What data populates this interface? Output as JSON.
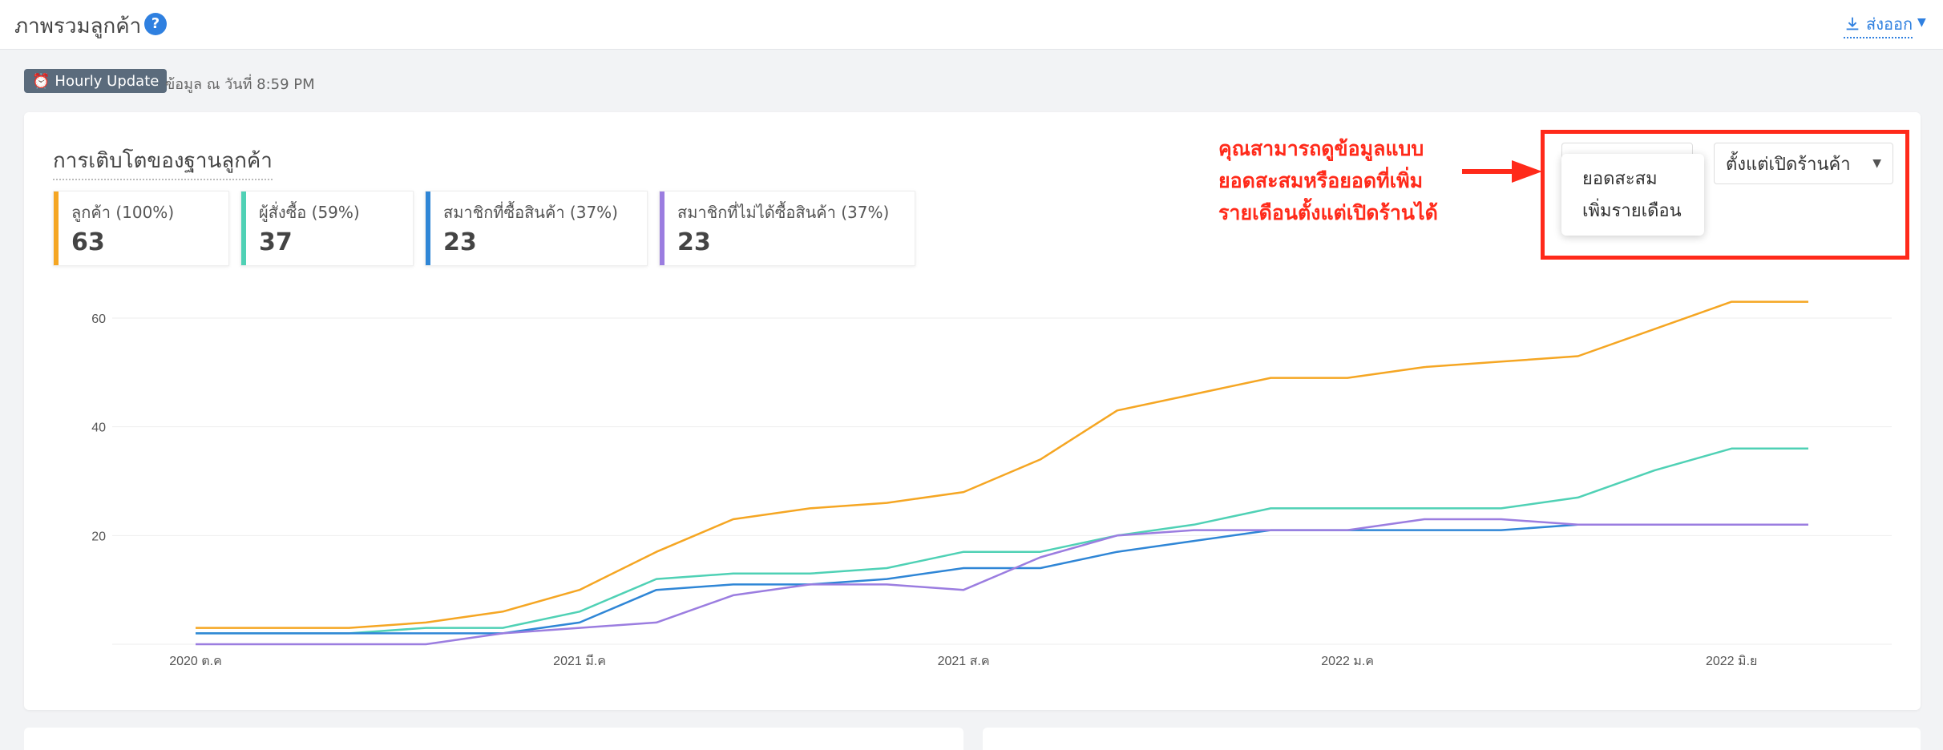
{
  "header": {
    "title": "ภาพรวมลูกค้า",
    "help_icon": "question-circle-icon",
    "export_label": "ส่งออก"
  },
  "update": {
    "badge_label": "Hourly Update",
    "timestamp": "ข้อมูล ณ วันที่ 8:59 PM"
  },
  "card": {
    "title": "การเติบโตของฐานลูกค้า",
    "stats": [
      {
        "label": "ลูกค้า (100%)",
        "value": "63",
        "color": "#f5a623"
      },
      {
        "label": "ผู้สั่งซื้อ (59%)",
        "value": "37",
        "color": "#4fd1b5"
      },
      {
        "label": "สมาชิกที่ซื้อสินค้า (37%)",
        "value": "23",
        "color": "#2f86d6"
      },
      {
        "label": "สมาชิกที่ไม่ได้ซื้อสินค้า (37%)",
        "value": "23",
        "color": "#9b7de0"
      }
    ],
    "annotation_lines": [
      "คุณสามารถดูข้อมูลแบบ",
      "ยอดสะสมหรือยอดที่เพิ่ม",
      "รายเดือนตั้งแต่เปิดร้านได้"
    ],
    "period_select": "ตั้งแต่เปิดร้านค้า",
    "mode_options": [
      "ยอดสะสม",
      "เพิ่มรายเดือน"
    ],
    "annotation_color": "#ff2a1a"
  },
  "chart_data": {
    "type": "line",
    "x": [
      "2020-10",
      "2020-11",
      "2020-12",
      "2021-01",
      "2021-02",
      "2021-03",
      "2021-04",
      "2021-05",
      "2021-06",
      "2021-07",
      "2021-08",
      "2021-09",
      "2021-10",
      "2021-11",
      "2021-12",
      "2022-01",
      "2022-02",
      "2022-03",
      "2022-04",
      "2022-05",
      "2022-06",
      "2022-07"
    ],
    "x_tick_labels": [
      "2020 ต.ค",
      "2021 มี.ค",
      "2021 ส.ค",
      "2022 ม.ค",
      "2022 มิ.ย"
    ],
    "x_tick_positions": [
      "2020-10",
      "2021-03",
      "2021-08",
      "2022-01",
      "2022-06"
    ],
    "ylim": [
      0,
      63
    ],
    "y_ticks": [
      20,
      40,
      60
    ],
    "grid": true,
    "series": [
      {
        "name": "ลูกค้า",
        "color": "#f5a623",
        "values": [
          3,
          3,
          3,
          4,
          6,
          10,
          17,
          23,
          25,
          26,
          28,
          34,
          43,
          46,
          49,
          49,
          51,
          52,
          53,
          58,
          63,
          63
        ]
      },
      {
        "name": "ผู้สั่งซื้อ",
        "color": "#4fd1b5",
        "values": [
          2,
          2,
          2,
          3,
          3,
          6,
          12,
          13,
          13,
          14,
          17,
          17,
          20,
          22,
          25,
          25,
          25,
          25,
          27,
          32,
          36,
          36
        ]
      },
      {
        "name": "สมาชิกที่ซื้อสินค้า",
        "color": "#2f86d6",
        "values": [
          2,
          2,
          2,
          2,
          2,
          4,
          10,
          11,
          11,
          12,
          14,
          14,
          17,
          19,
          21,
          21,
          21,
          21,
          22,
          22,
          22,
          22
        ]
      },
      {
        "name": "สมาชิกที่ไม่ได้ซื้อสินค้า",
        "color": "#9b7de0",
        "values": [
          0,
          0,
          0,
          0,
          2,
          3,
          4,
          9,
          11,
          11,
          10,
          16,
          20,
          21,
          21,
          21,
          23,
          23,
          22,
          22,
          22,
          22
        ]
      }
    ]
  }
}
